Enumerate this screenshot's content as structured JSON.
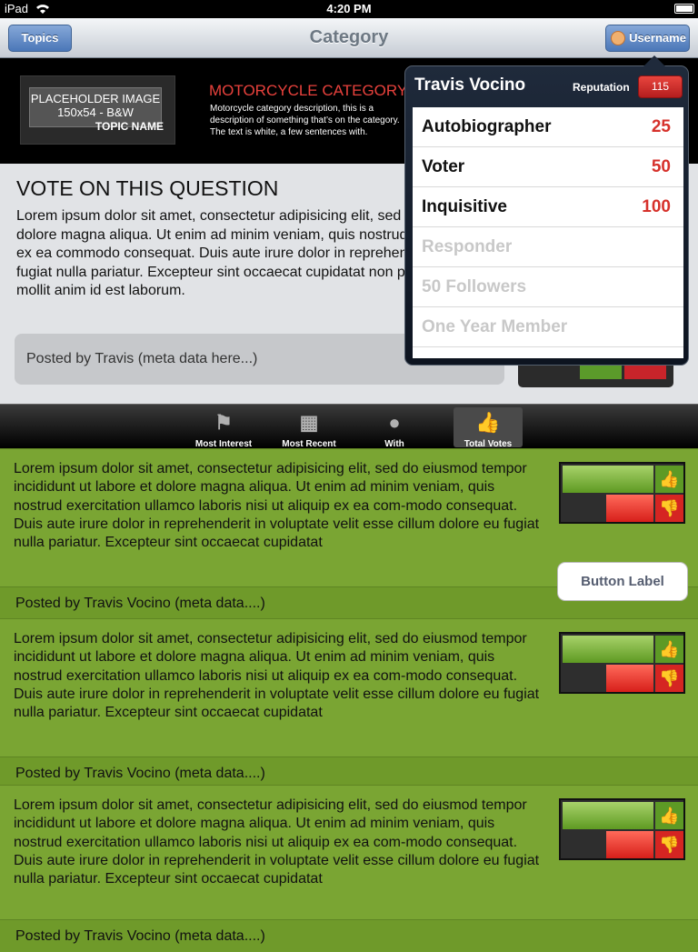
{
  "status": {
    "device": "iPad",
    "time": "4:20 PM"
  },
  "nav": {
    "left_button": "Topics",
    "title": "Category",
    "right_button": "Username"
  },
  "header": {
    "placeholder_line1": "PLACEHOLDER IMAGE",
    "placeholder_line2": "150x54  -  B&W",
    "topic_name": "TOPIC NAME",
    "category_title": "MOTORCYCLE CATEGORY",
    "category_desc": "Motorcycle category description, this is a description of something that’s on the category. The text is white, a few sentences with."
  },
  "question": {
    "title": "VOTE ON THIS QUESTION",
    "body": "Lorem ipsum dolor sit amet, consectetur adipisicing elit, sed do eiusmod tempor incididunt ut labore et dolore magna aliqua. Ut enim ad minim veniam, quis nostrud exercitation ullamco laboris nisi ut aliquip ex ea commodo consequat. Duis aute irure dolor in reprehenderit in voluptate velit esse cillum dolore eu fugiat nulla pariatur. Excepteur sint occaecat cupidatat non proident, sunt in culpa qui officia deserunt mollit anim id est laborum.",
    "posted": "Posted by Travis (meta data here...)"
  },
  "tabs": [
    {
      "label": "Most Interest",
      "icon": "flag-icon"
    },
    {
      "label": "Most Recent",
      "icon": "calendar-icon"
    },
    {
      "label": "With Responses",
      "icon": "speech-bubble-icon"
    },
    {
      "label": "Total Votes",
      "icon": "thumbs-up-icon",
      "selected": true
    }
  ],
  "posts": [
    {
      "text": "Lorem ipsum dolor sit amet, consectetur adipisicing elit, sed do eiusmod tempor incididunt ut labore et dolore magna aliqua. Ut enim ad minim veniam, quis nostrud exercitation ullamco laboris nisi ut aliquip ex ea com-modo consequat. Duis aute irure dolor in reprehenderit in voluptate velit esse cillum dolore eu fugiat nulla pariatur. Excepteur sint occaecat cupidatat",
      "meta": "Posted by Travis Vocino (meta data....)"
    },
    {
      "text": "Lorem ipsum dolor sit amet, consectetur adipisicing elit, sed do eiusmod tempor incididunt ut labore et dolore magna aliqua. Ut enim ad minim veniam, quis nostrud exercitation ullamco laboris nisi ut aliquip ex ea com-modo consequat. Duis aute irure dolor in reprehenderit in voluptate velit esse cillum dolore eu fugiat nulla pariatur. Excepteur sint occaecat cupidatat",
      "meta": "Posted by Travis Vocino (meta data....)"
    },
    {
      "text": "Lorem ipsum dolor sit amet, consectetur adipisicing elit, sed do eiusmod tempor incididunt ut labore et dolore magna aliqua. Ut enim ad minim veniam, quis nostrud exercitation ullamco laboris nisi ut aliquip ex ea com-modo consequat. Duis aute irure dolor in reprehenderit in voluptate velit esse cillum dolore eu fugiat nulla pariatur. Excepteur sint occaecat cupidatat",
      "meta": "Posted by Travis Vocino (meta data....)"
    }
  ],
  "button_label": "Button Label",
  "popover": {
    "name": "Travis Vocino",
    "reputation_label": "Reputation",
    "reputation": "115",
    "badges": [
      {
        "label": "Autobiographer",
        "value": "25",
        "earned": true
      },
      {
        "label": "Voter",
        "value": "50",
        "earned": true
      },
      {
        "label": "Inquisitive",
        "value": "100",
        "earned": true
      },
      {
        "label": "Responder",
        "value": "",
        "earned": false
      },
      {
        "label": "50 Followers",
        "value": "",
        "earned": false
      },
      {
        "label": "One Year Member",
        "value": "",
        "earned": false
      }
    ]
  },
  "colors": {
    "accent_green": "#7aa533",
    "accent_red": "#d6312b",
    "nav_blue": "#4b77b8"
  }
}
